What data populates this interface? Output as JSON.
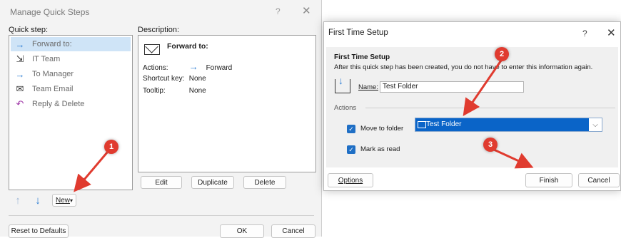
{
  "manage_quick_steps": {
    "title": "Manage Quick Steps",
    "help": "?",
    "close": "✕",
    "quick_step_label": "Quick step:",
    "description_label": "Description:",
    "items": [
      {
        "label": "Forward to:",
        "icon": "forward-arrow-icon",
        "glyph": "→",
        "selected": true
      },
      {
        "label": "IT Team",
        "icon": "team-icon",
        "glyph": "⇲",
        "selected": false
      },
      {
        "label": "To Manager",
        "icon": "forward-arrow-icon",
        "glyph": "→",
        "selected": false
      },
      {
        "label": "Team Email",
        "icon": "envelope-icon",
        "glyph": "✉",
        "selected": false
      },
      {
        "label": "Reply & Delete",
        "icon": "reply-icon",
        "glyph": "↶",
        "selected": false
      }
    ],
    "description": {
      "title": "Forward to:",
      "actions_label": "Actions:",
      "actions_value": "Forward",
      "shortcut_label": "Shortcut key:",
      "shortcut_value": "None",
      "tooltip_label": "Tooltip:",
      "tooltip_value": "None"
    },
    "edit_button": "Edit",
    "duplicate_button": "Duplicate",
    "delete_button": "Delete",
    "up_glyph": "↑",
    "down_glyph": "↓",
    "new_button": "New",
    "new_caret": "▾",
    "reset_button": "Reset to Defaults",
    "ok_button": "OK",
    "cancel_button": "Cancel"
  },
  "first_time_setup": {
    "title": "First Time Setup",
    "help": "?",
    "close": "✕",
    "heading": "First Time Setup",
    "info": "After this quick step has been created, you do not have to enter this information again.",
    "name_label": "Name:",
    "name_value": "Test Folder",
    "actions_label": "Actions",
    "move_label": "Move to folder",
    "move_value": "Test Folder",
    "mark_read_label": "Mark as read",
    "check_glyph": "✓",
    "dropdown_glyph": "⌵",
    "options_button": "Options",
    "finish_button": "Finish",
    "cancel_button": "Cancel"
  },
  "annotations": {
    "badge1": "1",
    "badge2": "2",
    "badge3": "3",
    "arrow_color": "#e03b2f"
  }
}
